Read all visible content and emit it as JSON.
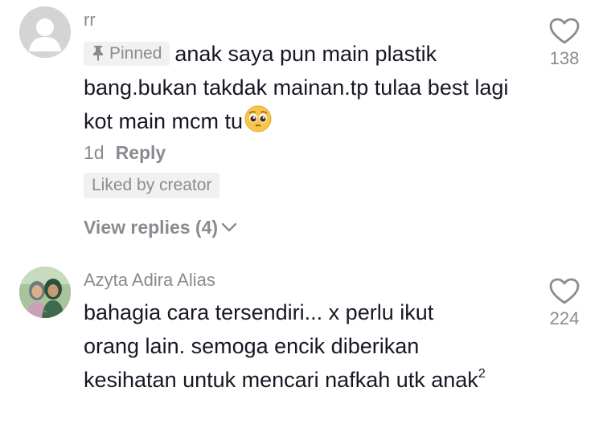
{
  "comments": [
    {
      "username": "rr",
      "pinned_label": "Pinned",
      "text": "anak saya pun main plastik bang.bukan takdak mainan.tp tulaa best lagi kot main mcm tu",
      "emoji": "pleading-face",
      "age": "1d",
      "reply_label": "Reply",
      "liked_by_creator_label": "Liked by creator",
      "view_replies_label": "View replies (4)",
      "likes": "138"
    },
    {
      "username": "Azyta Adira Alias",
      "text": "bahagia cara tersendiri... x perlu ikut orang lain. semoga encik diberikan kesihatan untuk mencari nafkah utk anak",
      "superscript": "2",
      "likes": "224"
    }
  ],
  "icons": {
    "like": "heart-outline-icon",
    "pin": "pin-icon",
    "expand": "chevron-down-icon"
  },
  "colors": {
    "text_primary": "#161823",
    "text_secondary": "#8a8b91",
    "badge_bg": "#f1f1f2"
  }
}
